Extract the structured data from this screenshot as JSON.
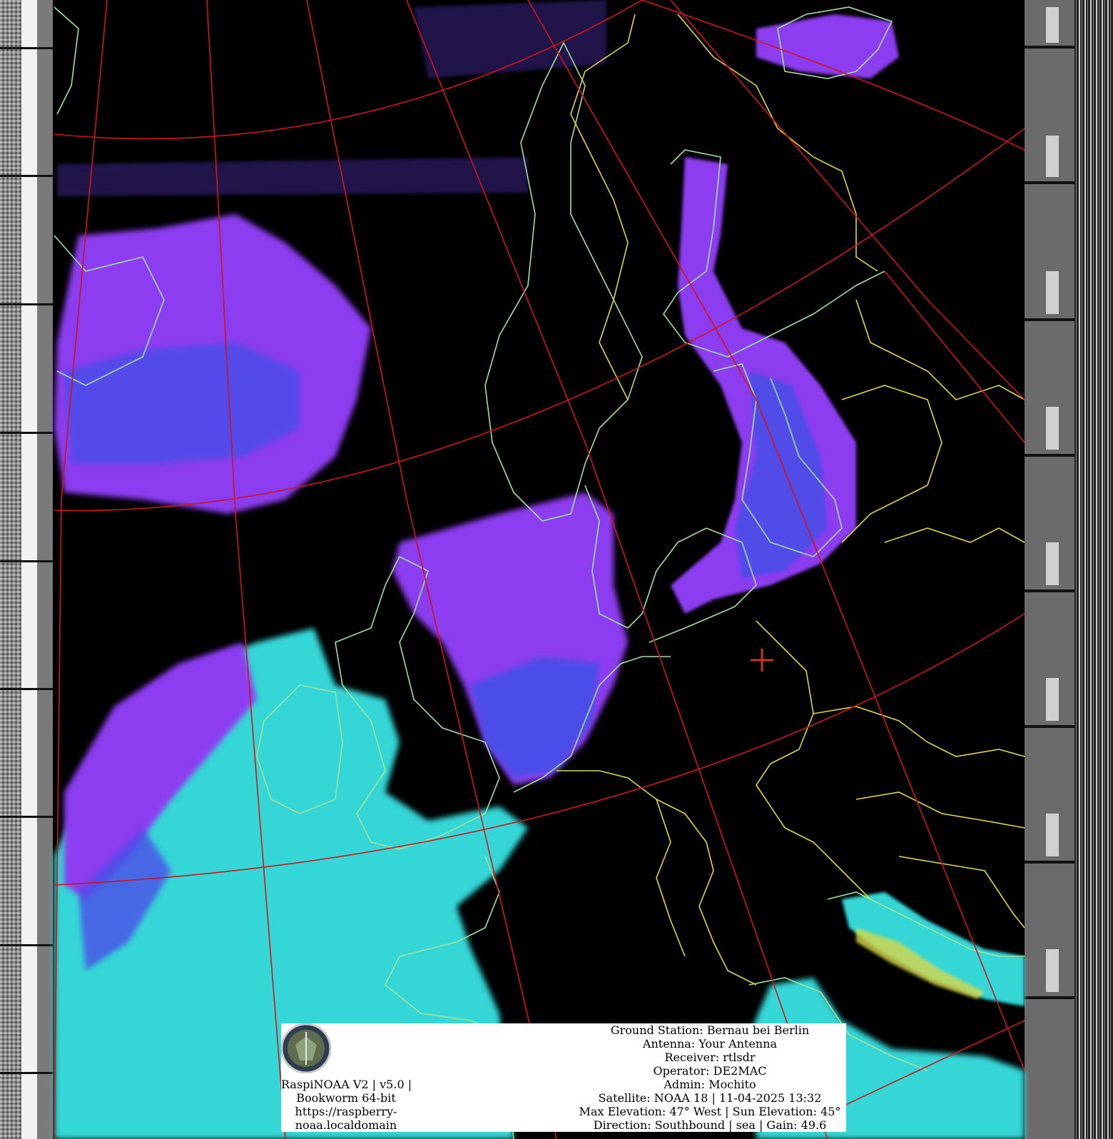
{
  "image": {
    "description_free": true,
    "marker": "crosshair",
    "colors": {
      "background": "#000000",
      "coastline": "#9fe29a",
      "border": "#e0d640",
      "graticule": "#d0161b",
      "cloud_high": "#8c3cf0",
      "cloud_mid": "#4b4ee8",
      "cloud_low": "#35d6d6",
      "marker": "#c0392b"
    }
  },
  "info": {
    "left_lines": [
      "RaspiNOAA V2 | v5.0 |",
      "Bookworm 64-bit",
      "https://raspberry-",
      "noaa.localdomain"
    ],
    "right_lines": [
      "Ground Station: Bernau bei Berlin",
      "Antenna: Your Antenna",
      "Receiver: rtlsdr",
      "Operator: DE2MAC",
      "Admin: Mochito",
      "Satellite: NOAA 18 | 11-04-2025 13:32",
      "Max Elevation: 47° West | Sun Elevation: 45°",
      "Direction: Southbound | sea | Gain: 49.6"
    ],
    "logo_icon": "station-logo-icon"
  }
}
